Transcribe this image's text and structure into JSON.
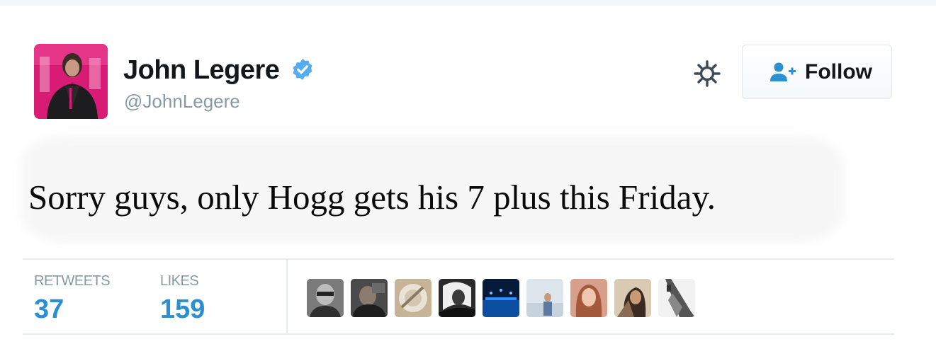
{
  "user": {
    "display_name": "John Legere",
    "handle": "@JohnLegere",
    "verified_icon": "verified-badge-icon",
    "avatar_icon": "profile-avatar"
  },
  "actions": {
    "settings_icon": "gear-icon",
    "follow_label": "Follow",
    "follow_icon": "add-user-icon"
  },
  "tweet": {
    "text": "Sorry guys, only Hogg gets his 7 plus this Friday."
  },
  "stats": {
    "retweets_label": "RETWEETS",
    "retweets_count": "37",
    "likes_label": "LIKES",
    "likes_count": "159"
  },
  "likers": [
    {
      "name": "liker-avatar-1",
      "color": "#6b6b6b"
    },
    {
      "name": "liker-avatar-2",
      "color": "#3a3a3a"
    },
    {
      "name": "liker-avatar-3",
      "color": "#b8a48a"
    },
    {
      "name": "liker-avatar-4",
      "color": "#2a2a2a"
    },
    {
      "name": "liker-avatar-5",
      "color": "#0a3f7a"
    },
    {
      "name": "liker-avatar-6",
      "color": "#d6dfe6"
    },
    {
      "name": "liker-avatar-7",
      "color": "#c98a6b"
    },
    {
      "name": "liker-avatar-8",
      "color": "#c9b8a0"
    },
    {
      "name": "liker-avatar-9",
      "color": "#8a8a8a"
    }
  ],
  "colors": {
    "link_blue": "#2b8fd1",
    "verified_blue": "#55acee",
    "muted_gray": "#8899a6",
    "brand_magenta": "#e0197a"
  }
}
